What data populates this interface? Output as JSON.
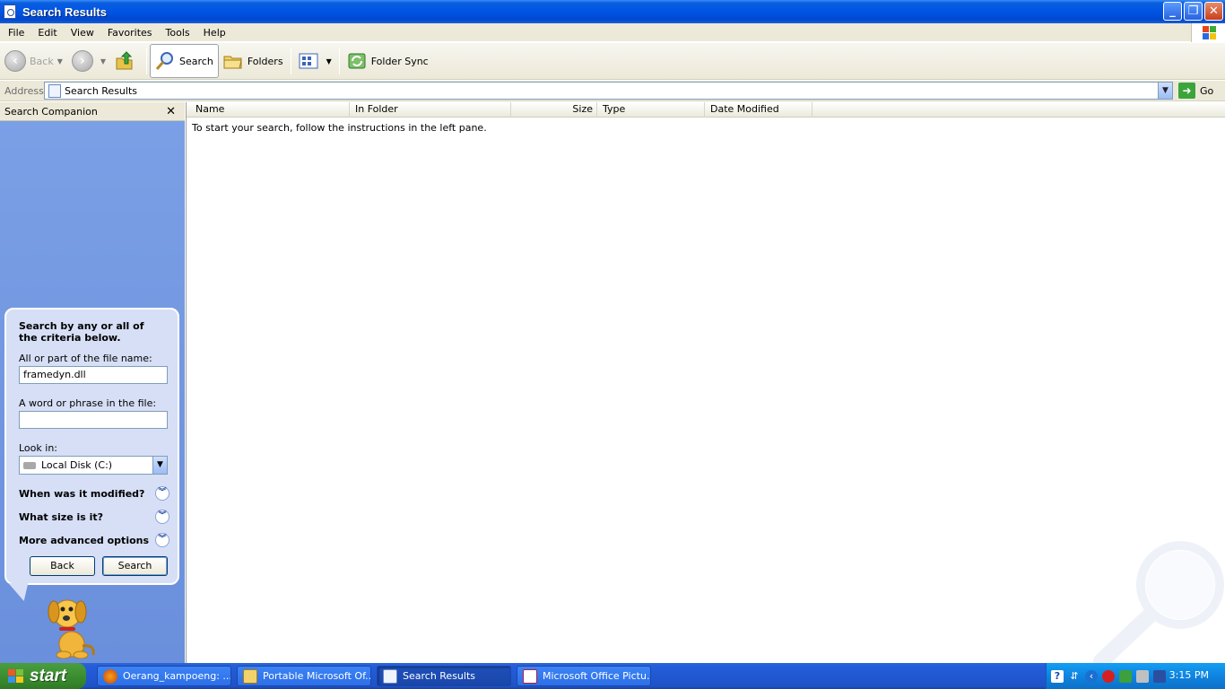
{
  "window": {
    "title": "Search Results"
  },
  "menu": [
    "File",
    "Edit",
    "View",
    "Favorites",
    "Tools",
    "Help"
  ],
  "toolbar": {
    "back": "Back",
    "search": "Search",
    "folders": "Folders",
    "folder_sync": "Folder Sync"
  },
  "address": {
    "label": "Address",
    "value": "Search Results",
    "go": "Go"
  },
  "search_companion": {
    "title": "Search Companion",
    "heading": "Search by any or all of the criteria below.",
    "filename_label": "All or part of the file name:",
    "filename_value": "framedyn.dll",
    "phrase_label": "A word or phrase in the file:",
    "phrase_value": "",
    "lookin_label": "Look in:",
    "lookin_value": "Local Disk (C:)",
    "options": [
      "When was it modified?",
      "What size is it?",
      "More advanced options"
    ],
    "back_button": "Back",
    "search_button": "Search"
  },
  "results": {
    "columns": [
      "Name",
      "In Folder",
      "Size",
      "Type",
      "Date Modified"
    ],
    "empty_message": "To start your search, follow the instructions in the left pane."
  },
  "taskbar": {
    "start": "start",
    "tasks": [
      {
        "label": "Oerang_kampoeng: ...",
        "active": false,
        "icon": "firefox-icon"
      },
      {
        "label": "Portable Microsoft Of...",
        "active": false,
        "icon": "folder-icon"
      },
      {
        "label": "Search Results",
        "active": true,
        "icon": "search-results-icon"
      },
      {
        "label": "Microsoft Office Pictu...",
        "active": false,
        "icon": "picture-manager-icon"
      }
    ],
    "clock": "3:15 PM"
  },
  "colors": {
    "titlebar": "#0054e3",
    "chrome": "#ece9d8",
    "companion_bg": "#7ba0e6",
    "taskbar": "#245edb",
    "start": "#3c8e31"
  }
}
